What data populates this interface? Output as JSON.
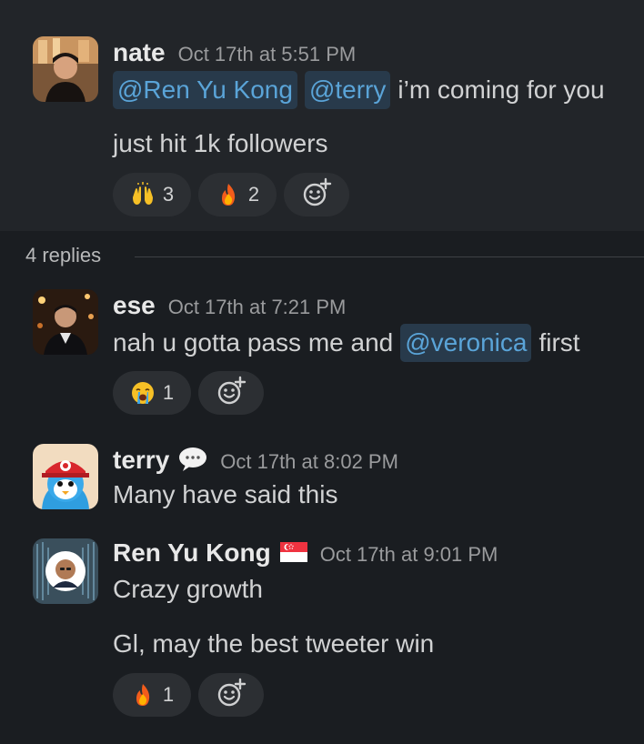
{
  "thread": {
    "parent": {
      "sender": "nate",
      "timestamp": "Oct 17th at 5:51 PM",
      "mentions": [
        "@Ren Yu Kong",
        "@terry"
      ],
      "text_after_mentions": "i’m coming for you",
      "second_line": "just hit 1k followers",
      "reactions": [
        {
          "emoji": "raised-hands",
          "count": "3"
        },
        {
          "emoji": "fire",
          "count": "2"
        }
      ]
    },
    "replies_label": "4 replies",
    "replies": [
      {
        "sender": "ese",
        "timestamp": "Oct 17th at 7:21 PM",
        "text_before_mention": "nah u gotta pass me and",
        "mention": "@veronica",
        "text_after_mention": "first",
        "reactions": [
          {
            "emoji": "loudly-crying-face",
            "count": "1"
          }
        ]
      },
      {
        "sender": "terry",
        "status_emoji": "speech-balloon",
        "timestamp": "Oct 17th at 8:02 PM",
        "text": "Many have said this"
      },
      {
        "sender": "Ren Yu Kong",
        "status_emoji": "flag-singapore",
        "timestamp": "Oct 17th at 9:01 PM",
        "line1": "Crazy growth",
        "line2": "Gl, may the best tweeter win",
        "reactions": [
          {
            "emoji": "fire",
            "count": "1"
          }
        ]
      }
    ]
  },
  "colors": {
    "background": "#1a1d21",
    "highlight_block": "#222529",
    "mention_text": "#5aa4d8",
    "mention_bg": "#283a4b",
    "reaction_pill": "#2c2f33"
  },
  "icons": [
    "add-reaction-icon",
    "raised-hands-icon",
    "fire-icon",
    "loudly-crying-face-icon",
    "speech-balloon-icon",
    "singapore-flag-icon"
  ]
}
